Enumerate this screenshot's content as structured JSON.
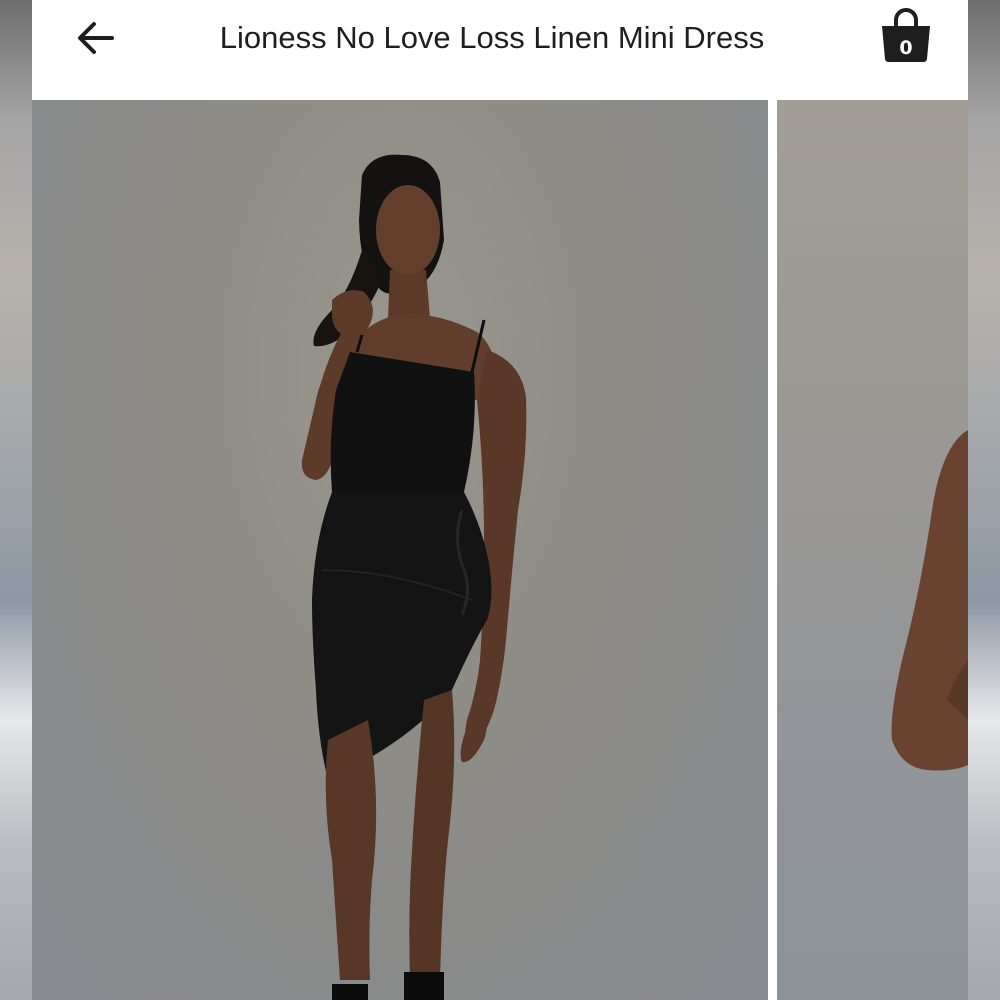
{
  "header": {
    "back_icon": "arrow-left-icon",
    "title": "Lioness No Love Loss Linen Mini Dress",
    "cart": {
      "icon": "shopping-bag-icon",
      "count": "0"
    }
  },
  "gallery": {
    "slide_count_visible": 2,
    "current_slide_index": 0
  },
  "colors": {
    "header_background": "#ffffff",
    "title_text": "#1e1e1e",
    "cart_badge": "#1e1e1e"
  }
}
